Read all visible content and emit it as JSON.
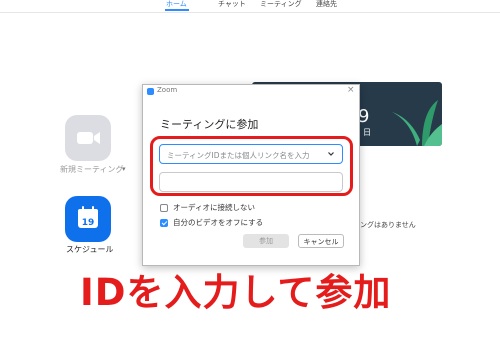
{
  "top_nav": {
    "items": [
      "ホーム",
      "チャット",
      "ミーティング",
      "連絡先"
    ],
    "active_index": 0
  },
  "home": {
    "new_meeting_label": "新規ミーティング",
    "new_meeting_caret": "▾",
    "schedule_label": "スケジュール",
    "calendar_day": "19",
    "clock_fragment": "9",
    "date_fragment": "日",
    "no_meetings_fragment": "ィングはありません"
  },
  "dialog": {
    "app_title": "Zoom",
    "close_symbol": "×",
    "heading": "ミーティングに参加",
    "meeting_id_placeholder": "ミーティングIDまたは個人リンク名を入力",
    "name_value": "",
    "no_audio_label": "オーディオに接続しない",
    "no_audio_checked": false,
    "video_off_label": "自分のビデオをオフにする",
    "video_off_checked": true,
    "join_label": "参加",
    "cancel_label": "キャンセル"
  },
  "caption": "IDを入力して参加",
  "colors": {
    "accent": "#2d8cff",
    "highlight": "#e51c1c",
    "zoom_blue": "#0e71eb",
    "dark_panel": "#263a4a"
  }
}
